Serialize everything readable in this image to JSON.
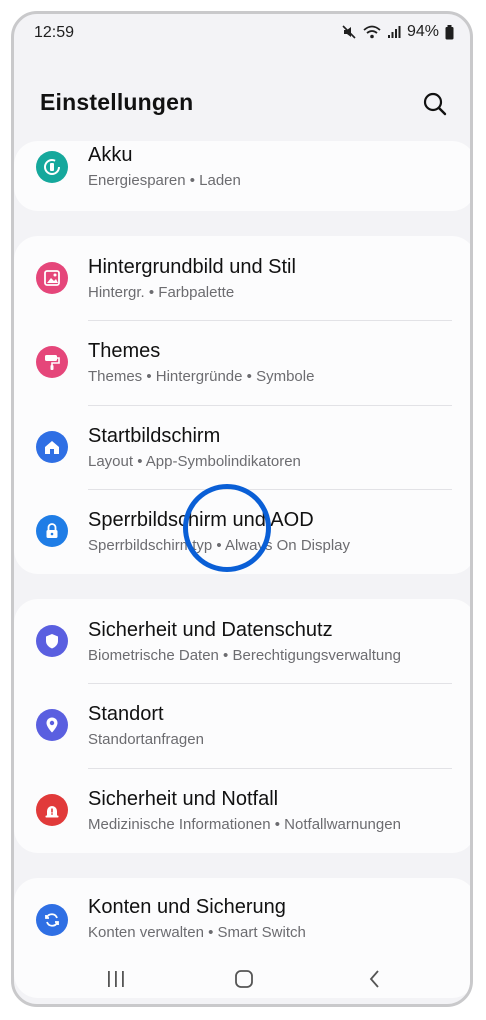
{
  "status_bar": {
    "time": "12:59",
    "battery_percent": "94%",
    "icons": [
      "mute-icon",
      "wifi-icon",
      "signal-icon",
      "battery-icon"
    ]
  },
  "header": {
    "title": "Einstellungen",
    "search_icon": "search-icon"
  },
  "colors": {
    "akku": "#15a89c",
    "wallpaper": "#e5467a",
    "themes": "#e5467a",
    "home": "#2f6fe4",
    "lock": "#1f7de6",
    "security": "#5a5fe0",
    "location": "#5a5fe0",
    "emergency": "#e13a3a",
    "accounts": "#2f6fe4"
  },
  "groups": [
    {
      "items": [
        {
          "title": "Akku",
          "subtitle": "Energiesparen  •  Laden",
          "icon": "battery-care-icon"
        }
      ]
    },
    {
      "items": [
        {
          "title": "Hintergrundbild und Stil",
          "subtitle": "Hintergr.  •  Farbpalette",
          "icon": "wallpaper-icon"
        },
        {
          "title": "Themes",
          "subtitle": "Themes  •  Hintergründe  •  Symbole",
          "icon": "paint-roller-icon"
        },
        {
          "title": "Startbildschirm",
          "subtitle": "Layout  •  App-Symbolindikatoren",
          "icon": "home-icon"
        },
        {
          "title": "Sperrbildschirm und AOD",
          "subtitle": "Sperrbildschirmtyp  •  Always On Display",
          "icon": "lock-icon"
        }
      ]
    },
    {
      "items": [
        {
          "title": "Sicherheit und Datenschutz",
          "subtitle": "Biometrische Daten  •  Berechtigungsverwaltung",
          "icon": "shield-icon"
        },
        {
          "title": "Standort",
          "subtitle": "Standortanfragen",
          "icon": "location-pin-icon"
        },
        {
          "title": "Sicherheit und Notfall",
          "subtitle": "Medizinische Informationen  •  Notfallwarnungen",
          "icon": "emergency-icon"
        }
      ]
    },
    {
      "items": [
        {
          "title": "Konten und Sicherung",
          "subtitle": "Konten verwalten  •  Smart Switch",
          "icon": "sync-icon"
        }
      ]
    }
  ],
  "nav_bar": {
    "icons": [
      "recent-apps-icon",
      "home-button-icon",
      "back-icon"
    ]
  }
}
